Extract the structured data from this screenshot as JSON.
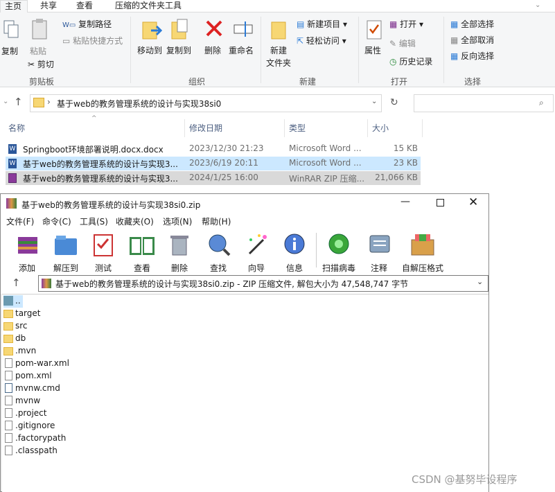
{
  "ribbon_tabs": [
    "主页",
    "共享",
    "查看",
    "压缩的文件夹工具"
  ],
  "ribbon": {
    "copy": "复制",
    "paste": "粘贴",
    "copy_path": "复制路径",
    "paste_shortcut": "粘贴快捷方式",
    "cut": "剪切",
    "clipboard": "剪贴板",
    "move_to": "移动到",
    "copy_to": "复制到",
    "delete": "删除",
    "rename": "重命名",
    "organize": "组织",
    "new_folder_1": "新建",
    "new_folder_2": "文件夹",
    "new_item": "新建项目",
    "easy_access": "轻松访问",
    "new": "新建",
    "properties": "属性",
    "open": "打开",
    "edit": "编辑",
    "history": "历史记录",
    "open_group": "打开",
    "select_all": "全部选择",
    "select_none": "全部取消",
    "invert": "反向选择",
    "select_group": "选择"
  },
  "address": {
    "path": "基于web的教务管理系统的设计与实现38si0",
    "search_placeholder": ""
  },
  "columns": {
    "name": "名称",
    "date": "修改日期",
    "type": "类型",
    "size": "大小"
  },
  "files": [
    {
      "name": "Springboot环境部署说明.docx.docx",
      "date": "2023/12/30 21:23",
      "type": "Microsoft Word ...",
      "size": "15 KB"
    },
    {
      "name": "基于web的教务管理系统的设计与实现3...",
      "date": "2023/6/19 20:11",
      "type": "Microsoft Word ...",
      "size": "23 KB"
    },
    {
      "name": "基于web的教务管理系统的设计与实现3...",
      "date": "2024/1/25 16:00",
      "type": "WinRAR ZIP 压缩...",
      "size": "21,066 KB"
    }
  ],
  "winrar": {
    "title": "基于web的教务管理系统的设计与实现38si0.zip",
    "menu": [
      "文件(F)",
      "命令(C)",
      "工具(S)",
      "收藏夹(O)",
      "选项(N)",
      "帮助(H)"
    ],
    "tools": [
      "添加",
      "解压到",
      "测试",
      "查看",
      "删除",
      "查找",
      "向导",
      "信息",
      "扫描病毒",
      "注释",
      "自解压格式"
    ],
    "path": "基于web的教务管理系统的设计与实现38si0.zip - ZIP 压缩文件, 解包大小为 47,548,747 字节",
    "entries": [
      "..",
      "target",
      "src",
      "db",
      ".mvn",
      "pom-war.xml",
      "pom.xml",
      "mvnw.cmd",
      "mvnw",
      ".project",
      ".gitignore",
      ".factorypath",
      ".classpath"
    ]
  },
  "watermark": "CSDN @基努毕设程序"
}
